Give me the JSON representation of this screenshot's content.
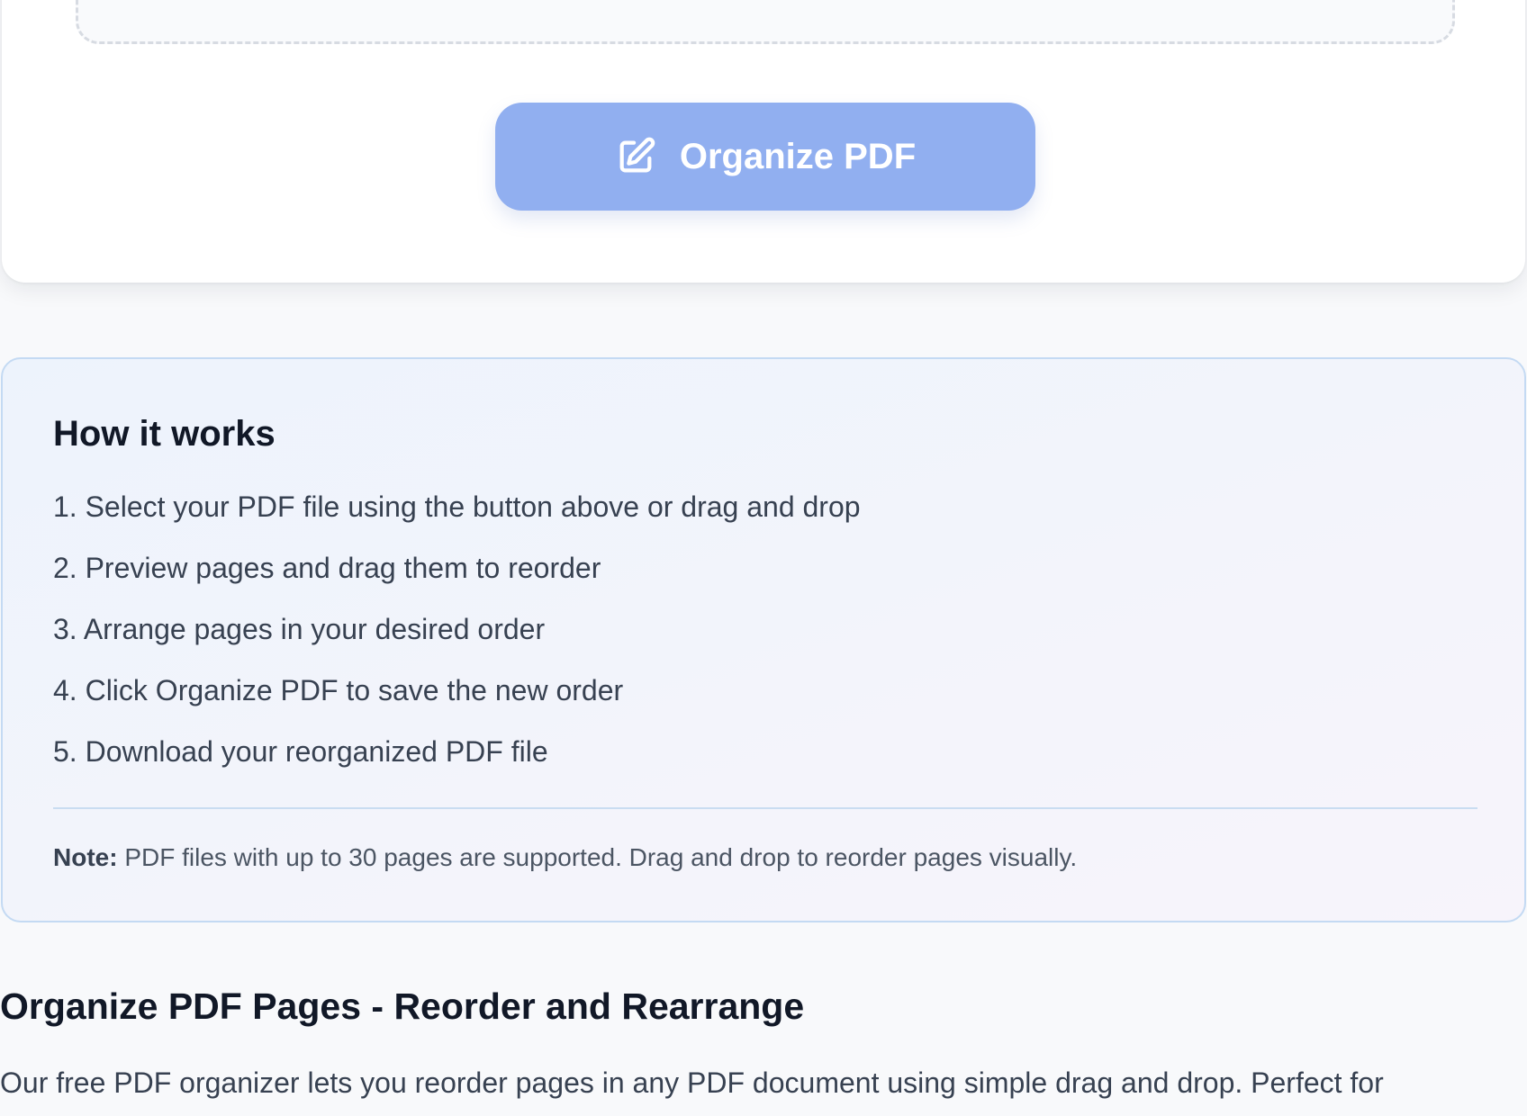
{
  "actions": {
    "organize_label": "Organize PDF"
  },
  "how_it_works": {
    "title": "How it works",
    "steps": [
      "1. Select your PDF file using the button above or drag and drop",
      "2. Preview pages and drag them to reorder",
      "3. Arrange pages in your desired order",
      "4. Click Organize PDF to save the new order",
      "5. Download your reorganized PDF file"
    ],
    "note_label": "Note:",
    "note_text": " PDF files with up to 30 pages are supported. Drag and drop to reorder pages visually."
  },
  "seo_section": {
    "title": "Organize PDF Pages - Reorder and Rearrange",
    "body": "Our free PDF organizer lets you reorder pages in any PDF document using simple drag and drop. Perfect for"
  },
  "colors": {
    "button_bg": "#91aff0",
    "panel_border": "#c4daf3",
    "text_dark": "#111827"
  },
  "icons": {
    "organize_button_icon": "edit-square-icon"
  }
}
